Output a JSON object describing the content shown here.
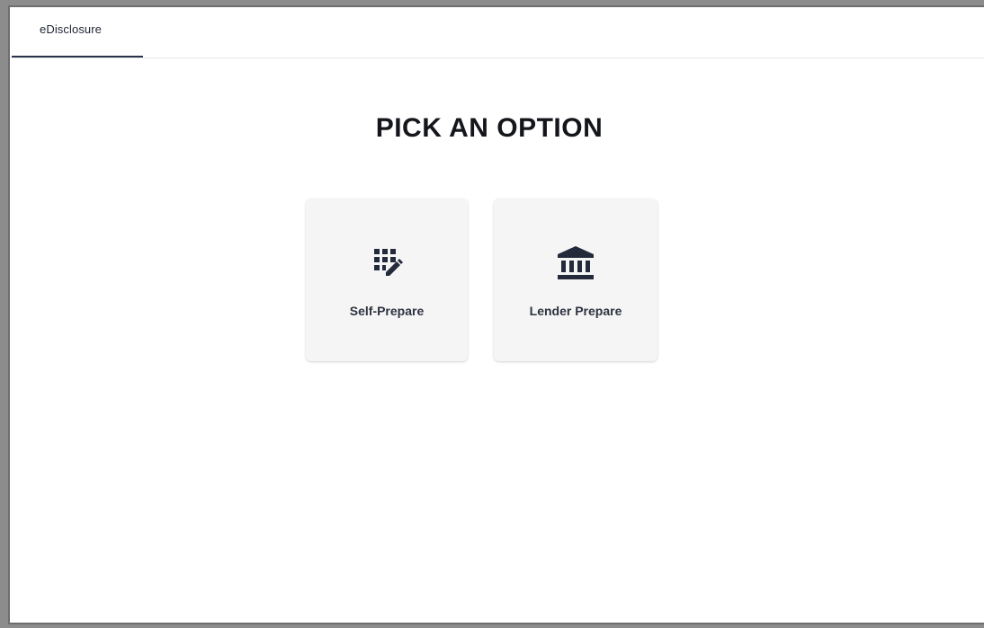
{
  "tabs": [
    {
      "label": "eDisclosure",
      "active": true
    }
  ],
  "main": {
    "heading": "PICK AN OPTION",
    "options": [
      {
        "label": "Self-Prepare",
        "icon": "grid-edit-icon"
      },
      {
        "label": "Lender Prepare",
        "icon": "bank-icon"
      }
    ]
  },
  "colors": {
    "accent": "#2a3347",
    "card_background": "#f5f5f5",
    "icon": "#232a3b"
  }
}
